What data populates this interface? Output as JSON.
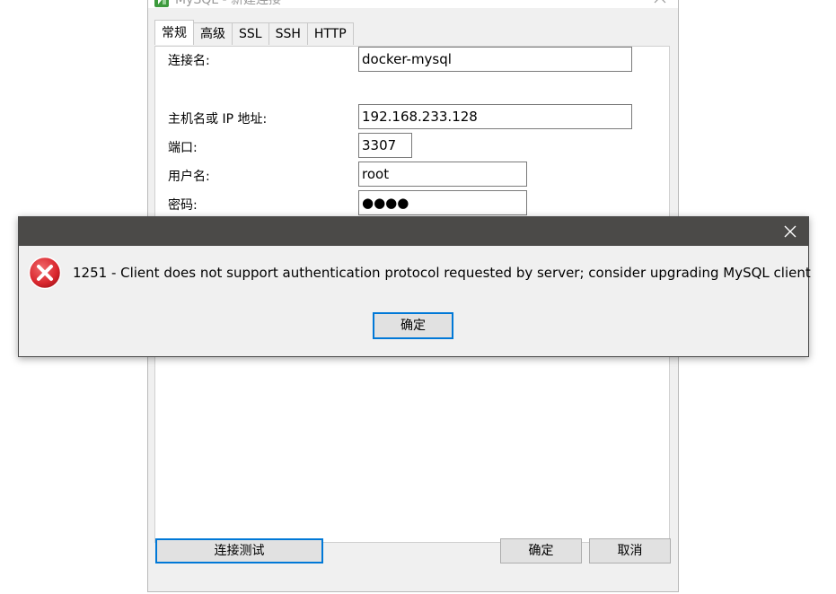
{
  "connection_dialog": {
    "title": "MySQL - 新建连接",
    "tabs": [
      {
        "label": "常规"
      },
      {
        "label": "高级"
      },
      {
        "label": "SSL"
      },
      {
        "label": "SSH"
      },
      {
        "label": "HTTP"
      }
    ],
    "active_tab": "常规",
    "fields": {
      "connection_name": {
        "label": "连接名:",
        "value": "docker-mysql"
      },
      "host": {
        "label": "主机名或 IP 地址:",
        "value": "192.168.233.128"
      },
      "port": {
        "label": "端口:",
        "value": "3307"
      },
      "username": {
        "label": "用户名:",
        "value": "root"
      },
      "password": {
        "label": "密码:",
        "value": "●●●●"
      }
    },
    "buttons": {
      "test_connection": "连接测试",
      "ok": "确定",
      "cancel": "取消"
    }
  },
  "error_dialog": {
    "message": "1251 - Client does not support authentication protocol requested by server; consider upgrading MySQL client",
    "ok_label": "确定"
  },
  "colors": {
    "accent": "#0078d7",
    "error_red": "#d9272e",
    "message_titlebar": "#4b4a48",
    "app_icon_green": "#3c9a3c"
  }
}
